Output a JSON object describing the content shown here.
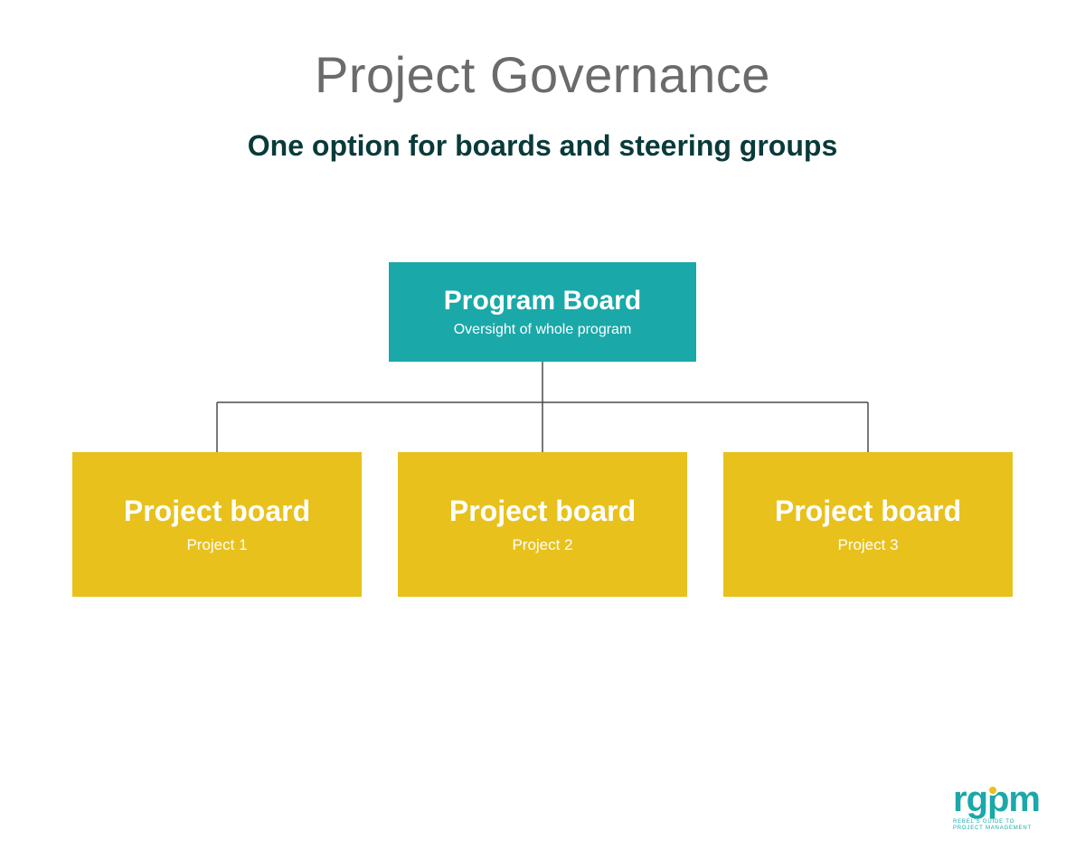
{
  "title": "Project Governance",
  "subtitle": "One option for boards and steering groups",
  "program_board": {
    "label": "Program Board",
    "caption": "Oversight of whole program"
  },
  "project_boards": [
    {
      "label": "Project board",
      "caption": "Project 1"
    },
    {
      "label": "Project board",
      "caption": "Project 2"
    },
    {
      "label": "Project board",
      "caption": "Project 3"
    }
  ],
  "logo": {
    "text": "rgpm",
    "tagline_line1": "REBEL'S GUIDE TO",
    "tagline_line2": "PROJECT MANAGEMENT"
  },
  "colors": {
    "title_gray": "#6b6b6b",
    "subtitle_dark": "#0a3a3a",
    "teal": "#1ba8a8",
    "yellow": "#e8c11c",
    "connector": "#4a4a4a"
  }
}
